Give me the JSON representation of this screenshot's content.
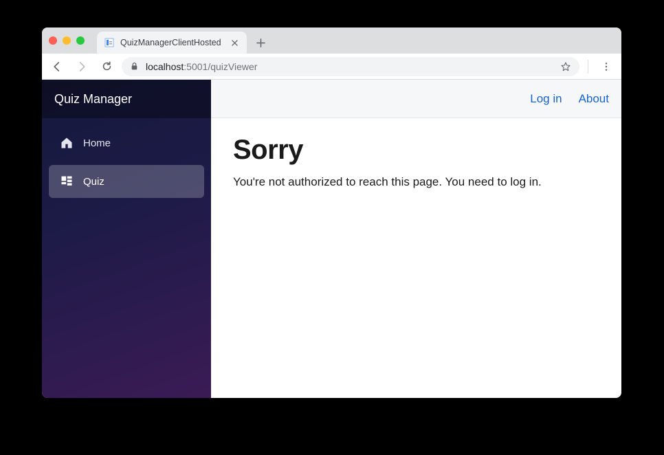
{
  "browser": {
    "tab_title": "QuizManagerClientHosted",
    "url_host": "localhost",
    "url_port": ":5001",
    "url_path": "/quizViewer"
  },
  "sidebar": {
    "brand": "Quiz Manager",
    "items": [
      {
        "icon": "home-icon",
        "label": "Home",
        "active": false
      },
      {
        "icon": "dashboard-icon",
        "label": "Quiz",
        "active": true
      }
    ]
  },
  "topbar": {
    "login_label": "Log in",
    "about_label": "About"
  },
  "main": {
    "heading": "Sorry",
    "message": "You're not authorized to reach this page. You need to log in."
  }
}
